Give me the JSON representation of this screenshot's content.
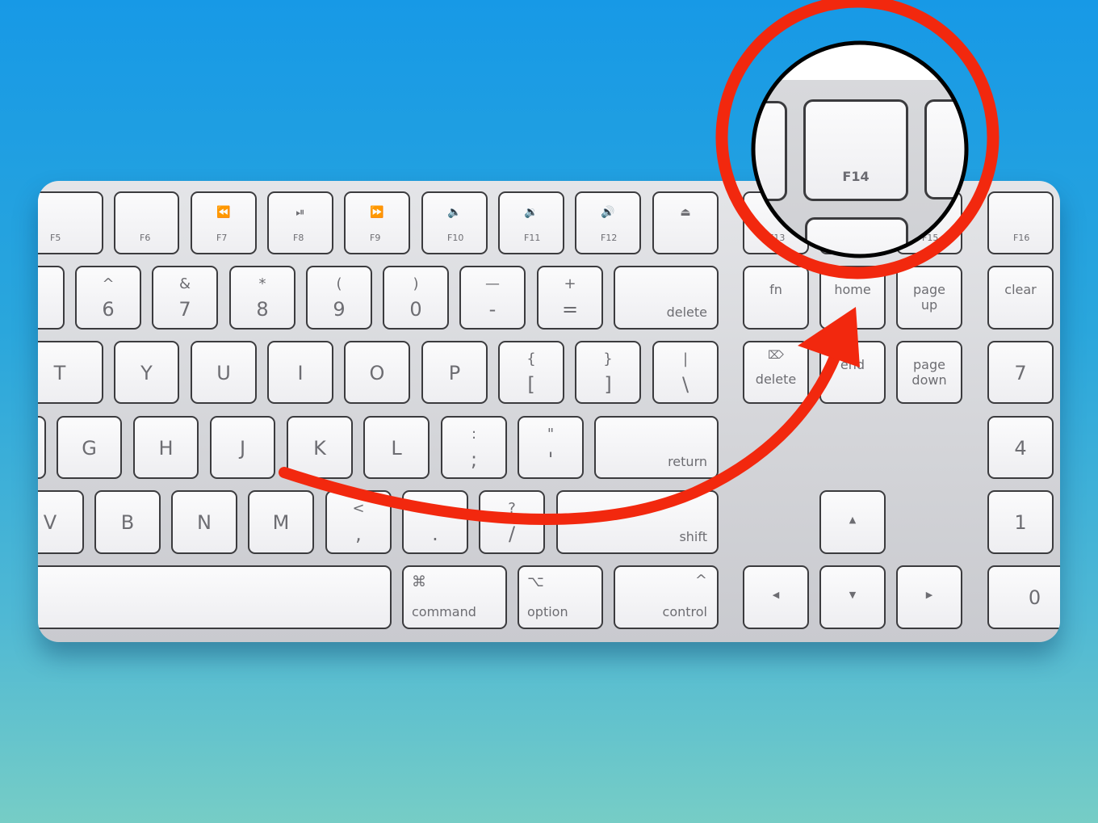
{
  "colors": {
    "annotation_red": "#f2280e",
    "magnifier_ring": "#000000",
    "key_face": "#f4f4f6",
    "key_border": "#3b3b3e"
  },
  "keyboard": {
    "rows": [
      [
        {
          "label": "F5"
        },
        {
          "label": "F6"
        },
        {
          "label": "F7",
          "icon": "⏪"
        },
        {
          "label": "F8",
          "icon": "⏯"
        },
        {
          "label": "F9",
          "icon": "⏩"
        },
        {
          "label": "F10",
          "icon": "🔈"
        },
        {
          "label": "F11",
          "icon": "🔉"
        },
        {
          "label": "F12",
          "icon": "🔊"
        },
        {
          "label": "",
          "icon": "⏏"
        },
        {
          "label": "F13"
        },
        {
          "label": "F14"
        },
        {
          "label": "F15"
        },
        {
          "label": "F16"
        }
      ],
      [
        {
          "label": ""
        },
        {
          "top": "^",
          "bottom": "6"
        },
        {
          "top": "&",
          "bottom": "7"
        },
        {
          "top": "*",
          "bottom": "8"
        },
        {
          "top": "(",
          "bottom": "9"
        },
        {
          "top": ")",
          "bottom": "0"
        },
        {
          "top": "—",
          "bottom": "-"
        },
        {
          "top": "+",
          "bottom": "="
        },
        {
          "label": "delete"
        },
        {
          "label": "fn"
        },
        {
          "label": "home"
        },
        {
          "label": "page\nup"
        },
        {
          "label": "clear"
        }
      ],
      [
        {
          "label": "T"
        },
        {
          "label": "Y"
        },
        {
          "label": "U"
        },
        {
          "label": "I"
        },
        {
          "label": "O"
        },
        {
          "label": "P"
        },
        {
          "top": "{",
          "bottom": "["
        },
        {
          "top": "}",
          "bottom": "]"
        },
        {
          "top": "|",
          "bottom": "\\"
        },
        {
          "label": "delete",
          "icon": "⌦"
        },
        {
          "label": "end"
        },
        {
          "label": "page\ndown"
        },
        {
          "label": "7"
        }
      ],
      [
        {
          "label": ""
        },
        {
          "label": "G"
        },
        {
          "label": "H"
        },
        {
          "label": "J"
        },
        {
          "label": "K"
        },
        {
          "label": "L"
        },
        {
          "top": ":",
          "bottom": ";"
        },
        {
          "top": "\"",
          "bottom": "'"
        },
        {
          "label": "return"
        },
        {
          "label": "4"
        }
      ],
      [
        {
          "label": "V"
        },
        {
          "label": "B"
        },
        {
          "label": "N"
        },
        {
          "label": "M"
        },
        {
          "top": "<",
          "bottom": ","
        },
        {
          "top": ">",
          "bottom": "."
        },
        {
          "top": "?",
          "bottom": "/"
        },
        {
          "label": "shift"
        },
        {
          "label": "▲"
        },
        {
          "label": "1"
        }
      ],
      [
        {
          "label": ""
        },
        {
          "label": "command",
          "icon": "⌘"
        },
        {
          "label": "option",
          "icon": "⌥"
        },
        {
          "label": "control",
          "icon": "^"
        },
        {
          "label": "◀"
        },
        {
          "label": "▼"
        },
        {
          "label": "▶"
        },
        {
          "label": "0"
        }
      ]
    ]
  },
  "magnifier": {
    "key_label": "F14"
  }
}
